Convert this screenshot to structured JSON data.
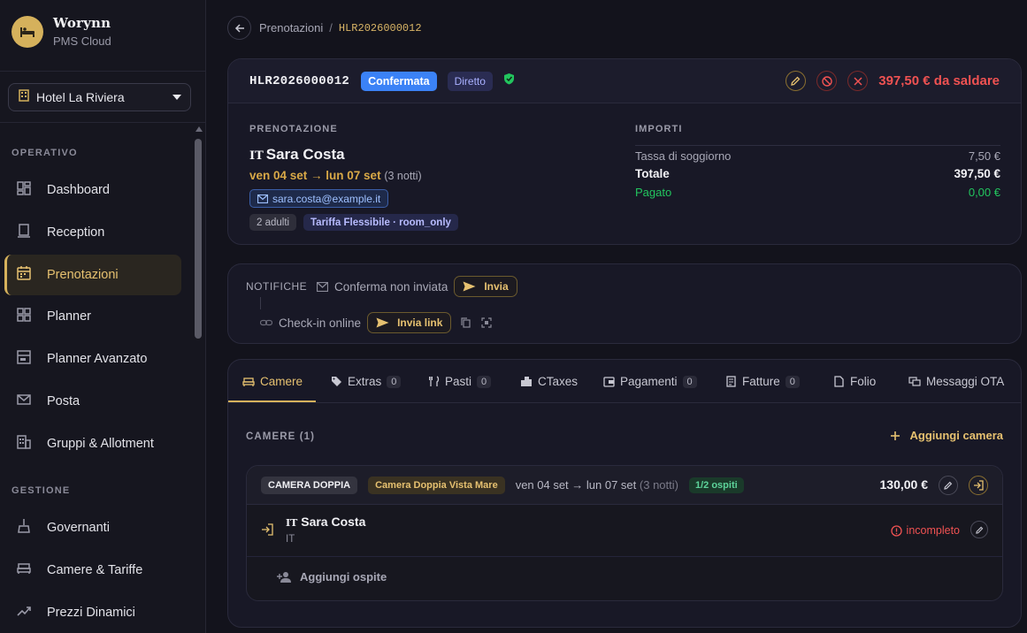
{
  "brand": {
    "name": "Worynn",
    "subtitle": "PMS Cloud",
    "accent": "#d5b15c"
  },
  "hotel_select": {
    "value": "Hotel La Riviera"
  },
  "sidebar": {
    "sections": [
      {
        "title": "OPERATIVO"
      },
      {
        "title": "GESTIONE"
      }
    ],
    "items": [
      {
        "label": "Dashboard",
        "icon": "dashboard-icon"
      },
      {
        "label": "Reception",
        "icon": "reception-icon"
      },
      {
        "label": "Prenotazioni",
        "icon": "calendar-icon",
        "active": true
      },
      {
        "label": "Planner",
        "icon": "grid-icon"
      },
      {
        "label": "Planner Avanzato",
        "icon": "timeline-icon"
      },
      {
        "label": "Posta",
        "icon": "mail-icon"
      },
      {
        "label": "Gruppi & Allotment",
        "icon": "building-icon"
      },
      {
        "label": "Governanti",
        "icon": "broom-icon"
      },
      {
        "label": "Camere & Tariffe",
        "icon": "bed-icon"
      },
      {
        "label": "Prezzi Dinamici",
        "icon": "trend-icon"
      }
    ]
  },
  "breadcrumb": {
    "parent": "Prenotazioni",
    "separator": "/",
    "current": "HLR2026000012"
  },
  "booking": {
    "code": "HLR2026000012",
    "status": "Confermata",
    "channel": "Diretto",
    "balance": "397,50 € da saldare",
    "section_label": "PRENOTAZIONE",
    "guest_flag": "IT",
    "guest_name": "Sara Costa",
    "dates": "ven 04 set → lun 07 set",
    "nights": "(3 notti)",
    "email": "sara.costa@example.it",
    "adults": "2 adulti",
    "rate": "Tariffa Flessibile · room_only",
    "colors": {
      "confirmed": "#3b82f6",
      "balance": "#f05252",
      "paid": "#22c55e"
    }
  },
  "amounts": {
    "section_label": "IMPORTI",
    "rows": [
      {
        "label": "Tassa di soggiorno",
        "value": "7,50 €"
      },
      {
        "label": "Totale",
        "value": "397,50 €"
      },
      {
        "label": "Pagato",
        "value": "0,00 €"
      }
    ]
  },
  "notifications": {
    "title": "NOTIFICHE",
    "confirm_status": "Conferma non inviata",
    "send_label": "Invia",
    "checkin_label": "Check-in online",
    "send_link_label": "Invia link"
  },
  "tabs": [
    {
      "label": "Camere",
      "icon": "bed-icon",
      "active": true
    },
    {
      "label": "Extras",
      "count": "0",
      "icon": "tag-icon"
    },
    {
      "label": "Pasti",
      "count": "0",
      "icon": "utensils-icon"
    },
    {
      "label": "CTaxes",
      "icon": "city-icon"
    },
    {
      "label": "Pagamenti",
      "count": "0",
      "icon": "wallet-icon"
    },
    {
      "label": "Fatture",
      "count": "0",
      "icon": "receipt-icon"
    },
    {
      "label": "Folio",
      "icon": "document-icon"
    },
    {
      "label": "Messaggi OTA",
      "icon": "chat-icon"
    }
  ],
  "rooms": {
    "section_label": "CAMERE (1)",
    "add_label": "Aggiungi camera",
    "room": {
      "type": "CAMERA DOPPIA",
      "name": "Camera Doppia Vista Mare",
      "dates": "ven 04 set → lun 07 set",
      "nights": "(3 notti)",
      "guests": "1/2 ospiti",
      "price": "130,00 €",
      "guest": {
        "flag": "IT",
        "name": "Sara Costa",
        "nationality": "IT",
        "status": "incompleto"
      },
      "add_guest_label": "Aggiungi ospite"
    }
  }
}
